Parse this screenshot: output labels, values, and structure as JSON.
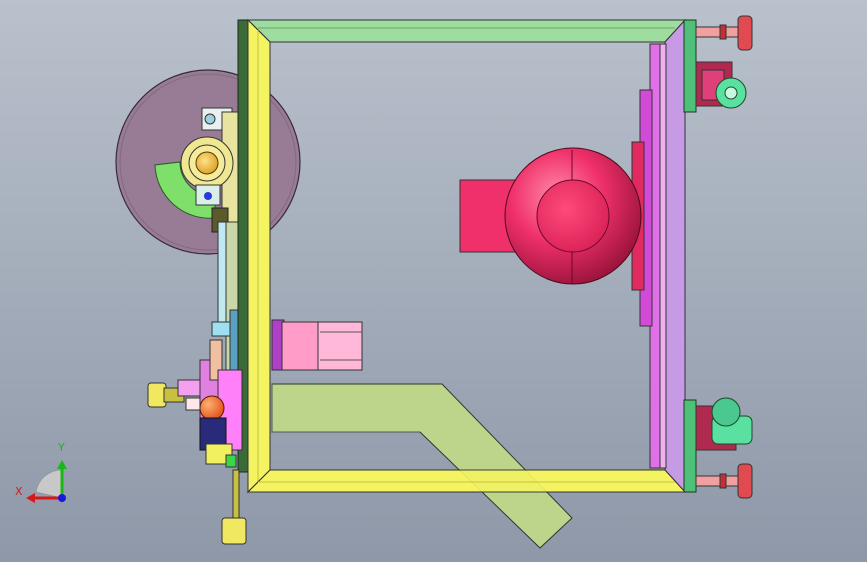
{
  "axes": {
    "x_label": "X",
    "y_label": "Y",
    "x_color": "#d81818",
    "y_color": "#18b818",
    "z_color": "#1818d8"
  },
  "colors": {
    "background_top": "#b9c1cc",
    "background_bottom": "#8e98a8",
    "frame_yellow": "#f4f462",
    "frame_green": "#9fdc9f",
    "motor_red": "#f0306a",
    "wheel_purple": "#987c96",
    "chute_olive": "#bcd58a",
    "panel_violet": "#c79ae6",
    "pink_block": "#ff9cc8"
  }
}
